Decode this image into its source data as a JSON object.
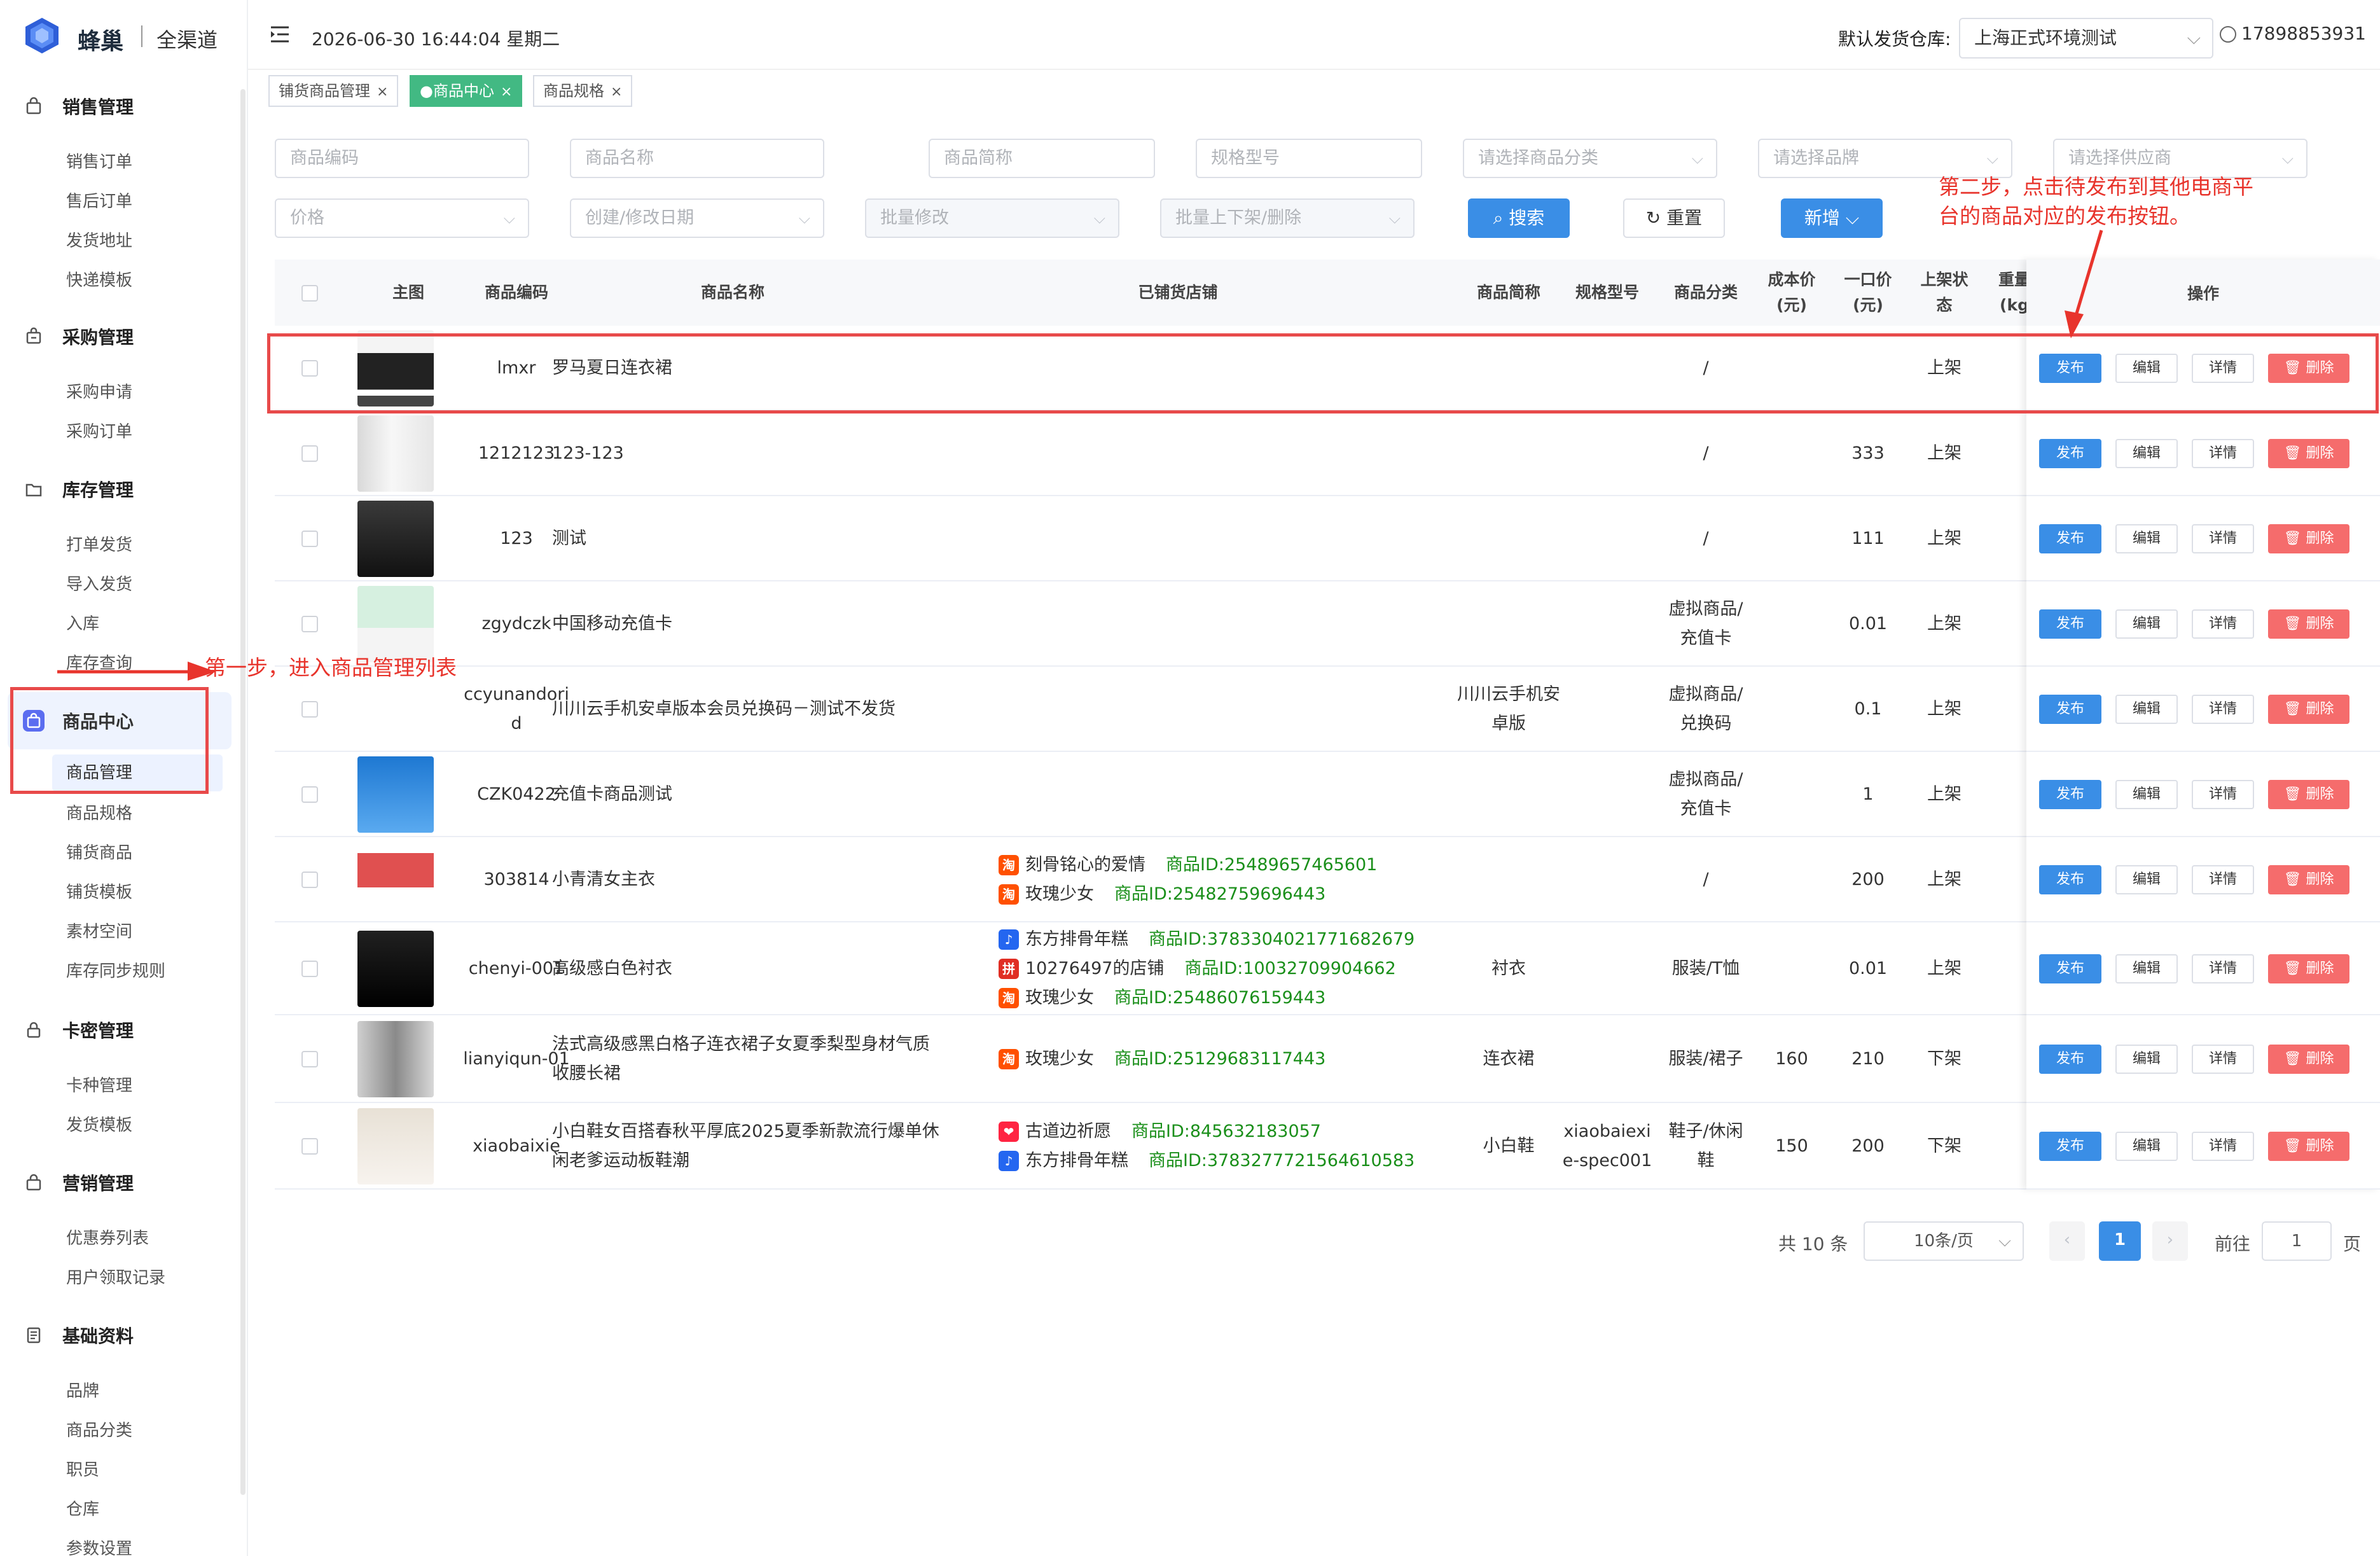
{
  "app": {
    "brand": "蜂巢",
    "brand_sub": "全渠道"
  },
  "topbar": {
    "datetime": "2026-06-30 16:44:04 星期二",
    "warehouse_label": "默认发货仓库:",
    "warehouse_value": "上海正式环境测试",
    "user": "17898853931"
  },
  "tabs": [
    {
      "label": "铺货商品管理",
      "active": false
    },
    {
      "label": "●商品中心",
      "active": true
    },
    {
      "label": "商品规格",
      "active": false
    }
  ],
  "sidebar": {
    "groups": [
      {
        "title": "销售管理",
        "icon": "shopping-bag-icon",
        "items": [
          "销售订单",
          "售后订单",
          "发货地址",
          "快递模板"
        ]
      },
      {
        "title": "采购管理",
        "icon": "purchase-icon",
        "items": [
          "采购申请",
          "采购订单"
        ]
      },
      {
        "title": "库存管理",
        "icon": "folder-icon",
        "items": [
          "打单发货",
          "导入发货",
          "入库",
          "库存查询"
        ]
      },
      {
        "title": "商品中心",
        "icon": "bag-icon",
        "items": [
          "商品管理",
          "商品规格",
          "铺货商品",
          "铺货模板",
          "素材空间",
          "库存同步规则"
        ]
      },
      {
        "title": "卡密管理",
        "icon": "lock-icon",
        "items": [
          "卡种管理",
          "发货模板"
        ]
      },
      {
        "title": "营销管理",
        "icon": "gift-icon",
        "items": [
          "优惠券列表",
          "用户领取记录"
        ]
      },
      {
        "title": "基础资料",
        "icon": "doc-icon",
        "items": [
          "品牌",
          "商品分类",
          "职员",
          "仓库",
          "参数设置"
        ]
      }
    ]
  },
  "filters": {
    "code": "商品编码",
    "name": "商品名称",
    "short": "商品简称",
    "spec": "规格型号",
    "category": "请选择商品分类",
    "brand": "请选择品牌",
    "supplier": "请选择供应商",
    "price": "价格",
    "date": "创建/修改日期",
    "batch_edit": "批量修改",
    "batch_shelf": "批量上下架/删除",
    "search": "搜索",
    "reset": "重置",
    "add": "新增"
  },
  "table": {
    "headers": {
      "image": "主图",
      "code": "商品编码",
      "name": "商品名称",
      "stores": "已铺货店铺",
      "short": "商品简称",
      "spec": "规格型号",
      "category": "商品分类",
      "cost_1": "成本价",
      "cost_2": "(元)",
      "price_1": "一口价",
      "price_2": "(元)",
      "status_1": "上架状",
      "status_2": "态",
      "weight_1": "重量",
      "weight_2": "(kg",
      "ops": "操作"
    },
    "rows": [
      {
        "code": "lmxr",
        "name": "罗马夏日连衣裙",
        "short": "",
        "spec": "",
        "category": "/",
        "cost": "",
        "price": "",
        "status": "上架",
        "stores": []
      },
      {
        "code": "1212123",
        "name": "123-123",
        "short": "",
        "spec": "",
        "category": "/",
        "cost": "",
        "price": "333",
        "status": "上架",
        "stores": []
      },
      {
        "code": "123",
        "name": "测试",
        "short": "",
        "spec": "",
        "category": "/",
        "cost": "",
        "price": "111",
        "status": "上架",
        "stores": []
      },
      {
        "code": "zgydczk",
        "name": "中国移动充值卡",
        "short": "",
        "spec": "",
        "category": "虚拟商品/充值卡",
        "cost": "",
        "price": "0.01",
        "status": "上架",
        "stores": []
      },
      {
        "code": "ccyunandorid",
        "name": "川川云手机安卓版本会员兑换码－测试不发货",
        "short": "川川云手机安卓版",
        "spec": "",
        "category": "虚拟商品/兑换码",
        "cost": "",
        "price": "0.1",
        "status": "上架",
        "stores": []
      },
      {
        "code": "CZK0422",
        "name": "充值卡商品测试",
        "short": "",
        "spec": "",
        "category": "虚拟商品/充值卡",
        "cost": "",
        "price": "1",
        "status": "上架",
        "stores": []
      },
      {
        "code": "303814",
        "name": "小青清女主衣",
        "short": "",
        "spec": "",
        "category": "/",
        "cost": "",
        "price": "200",
        "status": "上架",
        "stores": [
          {
            "icon": "taobao",
            "name": "刻骨铭心的爱情",
            "id": "商品ID:25489657465601"
          },
          {
            "icon": "taobao",
            "name": "玫瑰少女",
            "id": "商品ID:25482759696443"
          }
        ]
      },
      {
        "code": "chenyi-001",
        "name": "高级感白色衬衣",
        "short": "衬衣",
        "spec": "",
        "category": "服装/T恤",
        "cost": "",
        "price": "0.01",
        "status": "上架",
        "stores": [
          {
            "icon": "douyin",
            "name": "东方排骨年糕",
            "id": "商品ID:3783304021771682679"
          },
          {
            "icon": "pdd",
            "name": "10276497的店铺",
            "id": "商品ID:10032709904662"
          },
          {
            "icon": "taobao",
            "name": "玫瑰少女",
            "id": "商品ID:25486076159443"
          }
        ]
      },
      {
        "code": "lianyiqun-01",
        "name": "法式高级感黑白格子连衣裙子女夏季梨型身材气质收腰长裙",
        "short": "连衣裙",
        "spec": "",
        "category": "服装/裙子",
        "cost": "160",
        "price": "210",
        "status": "下架",
        "stores": [
          {
            "icon": "taobao",
            "name": "玫瑰少女",
            "id": "商品ID:25129683117443"
          }
        ]
      },
      {
        "code": "xiaobaixie",
        "name": "小白鞋女百搭春秋平厚底2025夏季新款流行爆单休闲老爹运动板鞋潮",
        "short": "小白鞋",
        "spec": "xiaobaiexie-spec001",
        "category": "鞋子/休闲鞋",
        "cost": "150",
        "price": "200",
        "status": "下架",
        "stores": [
          {
            "icon": "xhs",
            "name": "古道边祈愿",
            "id": "商品ID:845632183057"
          },
          {
            "icon": "douyin",
            "name": "东方排骨年糕",
            "id": "商品ID:3783277721564610583"
          }
        ]
      }
    ],
    "ops": {
      "publish": "发布",
      "edit": "编辑",
      "detail": "详情",
      "delete": "删除"
    }
  },
  "pagination": {
    "total": "共 10 条",
    "page_size": "10条/页",
    "current": "1",
    "goto": "前往",
    "goto_value": "1",
    "page_unit": "页"
  },
  "annotations": {
    "step1": "第一步，进入商品管理列表",
    "step2_line1": "第二步，点击待发布到其他电商平",
    "step2_line2": "台的商品对应的发布按钮。"
  },
  "colors": {
    "primary": "#3a8ee6",
    "danger": "#f56c6c",
    "success_tab": "#42b983",
    "annotation": "#e8342c",
    "store_id": "#1a8f1a"
  }
}
